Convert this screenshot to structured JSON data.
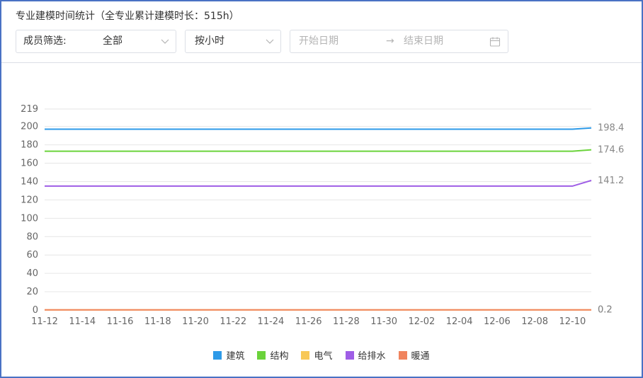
{
  "header": {
    "title": "专业建模时间统计（全专业累计建模时长：515h）"
  },
  "filters": {
    "member_label": "成员筛选:",
    "member_value": "全部",
    "granularity_value": "按小时",
    "start_placeholder": "开始日期",
    "range_separator": "→",
    "end_placeholder": "结束日期"
  },
  "icons": {
    "dropdown": "chevron-down-icon",
    "date": "calendar-icon"
  },
  "chart_data": {
    "type": "line",
    "x": [
      "11-12",
      "11-13",
      "11-14",
      "11-15",
      "11-16",
      "11-17",
      "11-18",
      "11-19",
      "11-20",
      "11-21",
      "11-22",
      "11-23",
      "11-24",
      "11-25",
      "11-26",
      "11-27",
      "11-28",
      "11-29",
      "11-30",
      "12-01",
      "12-02",
      "12-03",
      "12-04",
      "12-05",
      "12-06",
      "12-07",
      "12-08",
      "12-09",
      "12-10",
      "12-11"
    ],
    "x_tick_labels": [
      "11-12",
      "11-14",
      "11-16",
      "11-18",
      "11-20",
      "11-22",
      "11-24",
      "11-26",
      "11-28",
      "11-30",
      "12-02",
      "12-04",
      "12-06",
      "12-08",
      "12-10"
    ],
    "y_ticks": [
      0,
      20,
      40,
      60,
      80,
      100,
      120,
      140,
      160,
      180,
      200,
      219
    ],
    "ylim": [
      0,
      219
    ],
    "grid": true,
    "legend_position": "bottom",
    "series": [
      {
        "name": "建筑",
        "color": "#2d9ae8",
        "end_label": "198.4",
        "values": [
          197,
          197,
          197,
          197,
          197,
          197,
          197,
          197,
          197,
          197,
          197,
          197,
          197,
          197,
          197,
          197,
          197,
          197,
          197,
          197,
          197,
          197,
          197,
          197,
          197,
          197,
          197,
          197,
          197,
          198.4
        ]
      },
      {
        "name": "结构",
        "color": "#6bd33b",
        "end_label": "174.6",
        "values": [
          173,
          173,
          173,
          173,
          173,
          173,
          173,
          173,
          173,
          173,
          173,
          173,
          173,
          173,
          173,
          173,
          173,
          173,
          173,
          173,
          173,
          173,
          173,
          173,
          173,
          173,
          173,
          173,
          173,
          174.6
        ]
      },
      {
        "name": "电气",
        "color": "#f8c858",
        "end_label": "0.2",
        "values": [
          0.2,
          0.2,
          0.2,
          0.2,
          0.2,
          0.2,
          0.2,
          0.2,
          0.2,
          0.2,
          0.2,
          0.2,
          0.2,
          0.2,
          0.2,
          0.2,
          0.2,
          0.2,
          0.2,
          0.2,
          0.2,
          0.2,
          0.2,
          0.2,
          0.2,
          0.2,
          0.2,
          0.2,
          0.2,
          0.2
        ]
      },
      {
        "name": "给排水",
        "color": "#9f5ee6",
        "end_label": "141.2",
        "values": [
          135,
          135,
          135,
          135,
          135,
          135,
          135,
          135,
          135,
          135,
          135,
          135,
          135,
          135,
          135,
          135,
          135,
          135,
          135,
          135,
          135,
          135,
          135,
          135,
          135,
          135,
          135,
          135,
          135,
          141.2
        ]
      },
      {
        "name": "暖通",
        "color": "#f0845e",
        "end_label": "0.2",
        "values": [
          0.2,
          0.2,
          0.2,
          0.2,
          0.2,
          0.2,
          0.2,
          0.2,
          0.2,
          0.2,
          0.2,
          0.2,
          0.2,
          0.2,
          0.2,
          0.2,
          0.2,
          0.2,
          0.2,
          0.2,
          0.2,
          0.2,
          0.2,
          0.2,
          0.2,
          0.2,
          0.2,
          0.2,
          0.2,
          0.2
        ]
      }
    ]
  }
}
